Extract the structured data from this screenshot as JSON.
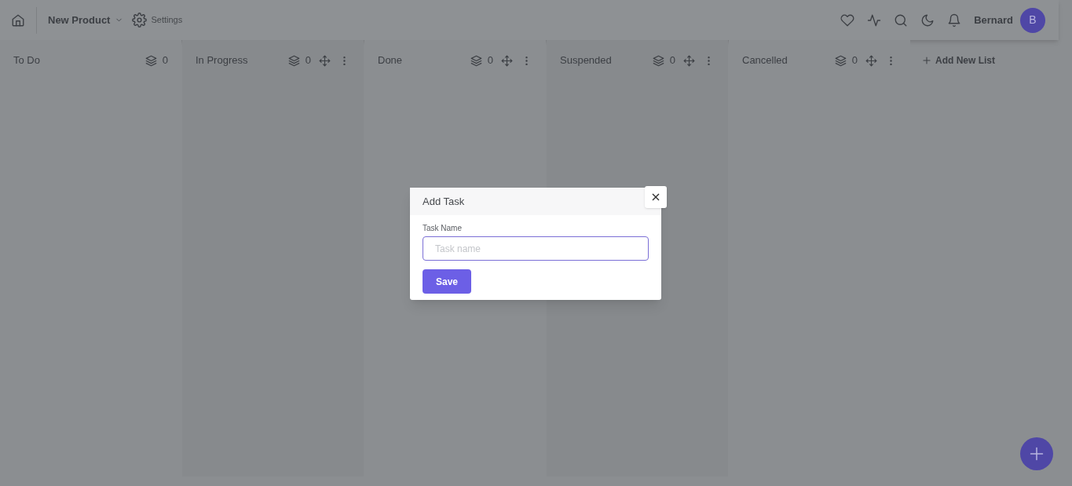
{
  "header": {
    "project": "New Product",
    "settings": "Settings",
    "user": "Bernard",
    "avatar": "B"
  },
  "lists": [
    {
      "title": "To Do",
      "count": "0",
      "kind": "fixed"
    },
    {
      "title": "In Progress",
      "count": "0",
      "kind": "movable"
    },
    {
      "title": "Done",
      "count": "0",
      "kind": "movable"
    },
    {
      "title": "Suspended",
      "count": "0",
      "kind": "movable"
    },
    {
      "title": "Cancelled",
      "count": "0",
      "kind": "movable"
    }
  ],
  "add_list": "Add New List",
  "modal": {
    "title": "Add Task",
    "field_label": "Task Name",
    "placeholder": "Task name",
    "save": "Save"
  }
}
